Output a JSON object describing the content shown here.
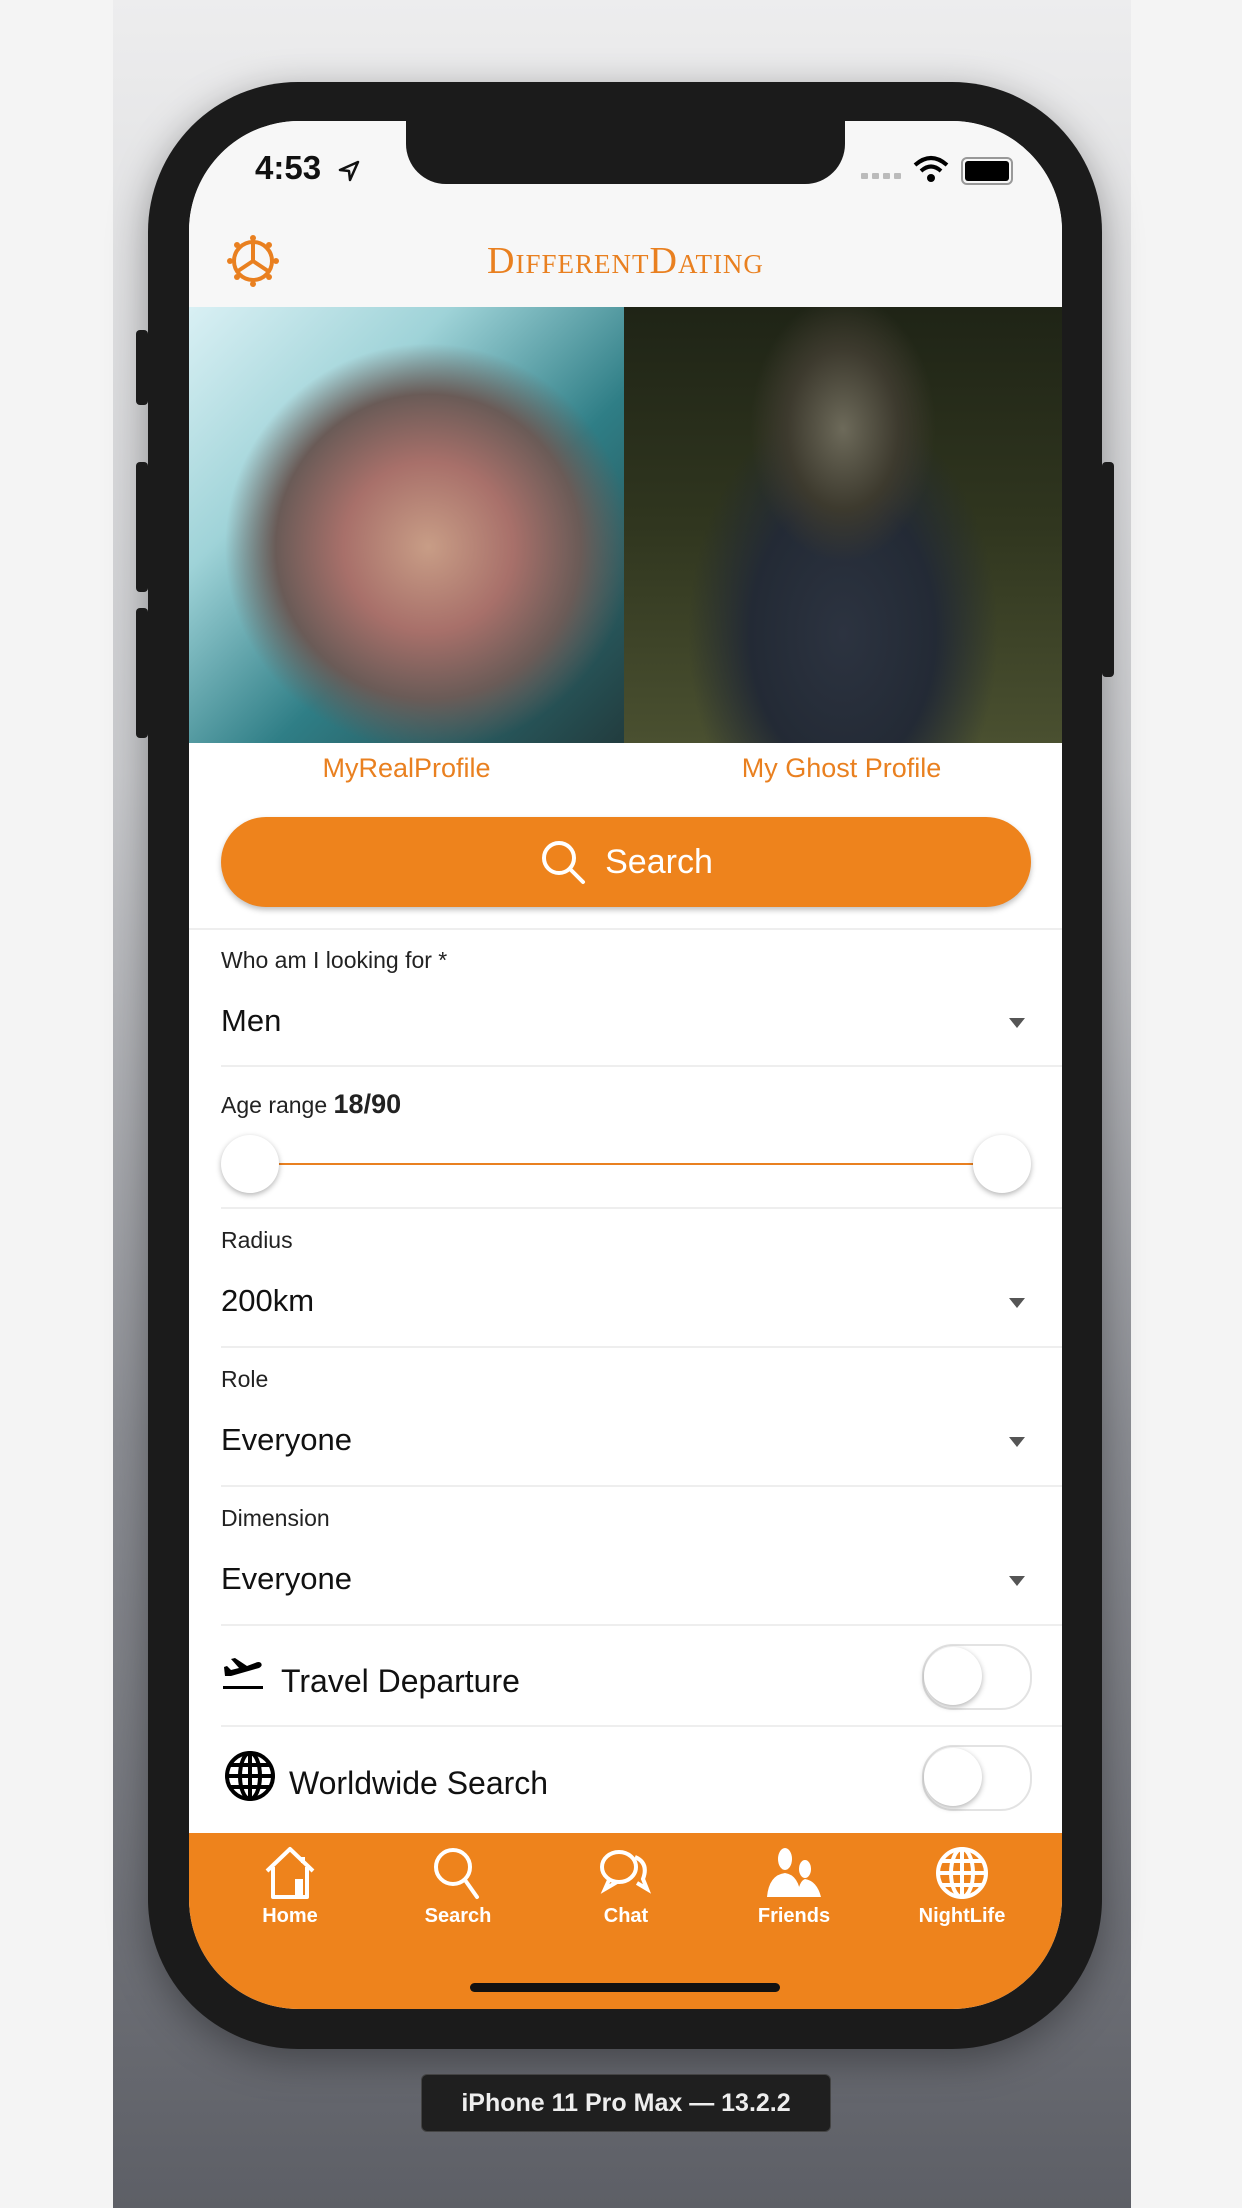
{
  "status_bar": {
    "time": "4:53"
  },
  "header": {
    "title": "DifferentDating",
    "settings_icon": "gear-icon"
  },
  "profiles": [
    {
      "label": "MyRealProfile"
    },
    {
      "label": "My Ghost Profile"
    }
  ],
  "search_button": {
    "label": "Search",
    "icon": "search-icon"
  },
  "filters": {
    "looking_for": {
      "label": "Who am I looking for *",
      "value": "Men"
    },
    "age_range": {
      "label": "Age range",
      "value": "18/90",
      "min": 18,
      "max": 90
    },
    "radius": {
      "label": "Radius",
      "value": "200km"
    },
    "role": {
      "label": "Role",
      "value": "Everyone"
    },
    "dimension": {
      "label": "Dimension",
      "value": "Everyone"
    },
    "travel_departure": {
      "label": "Travel Departure",
      "enabled": false,
      "icon": "airplane-departure-icon"
    },
    "worldwide_search": {
      "label": "Worldwide Search",
      "enabled": false,
      "icon": "globe-icon"
    }
  },
  "tabbar": {
    "items": [
      {
        "label": "Home",
        "icon": "home-icon"
      },
      {
        "label": "Search",
        "icon": "search-icon"
      },
      {
        "label": "Chat",
        "icon": "chat-icon"
      },
      {
        "label": "Friends",
        "icon": "friends-icon"
      },
      {
        "label": "NightLife",
        "icon": "globe-icon"
      }
    ]
  },
  "device_label": "iPhone 11 Pro Max — 13.2.2",
  "colors": {
    "accent": "#ee831c",
    "text": "#111111"
  }
}
